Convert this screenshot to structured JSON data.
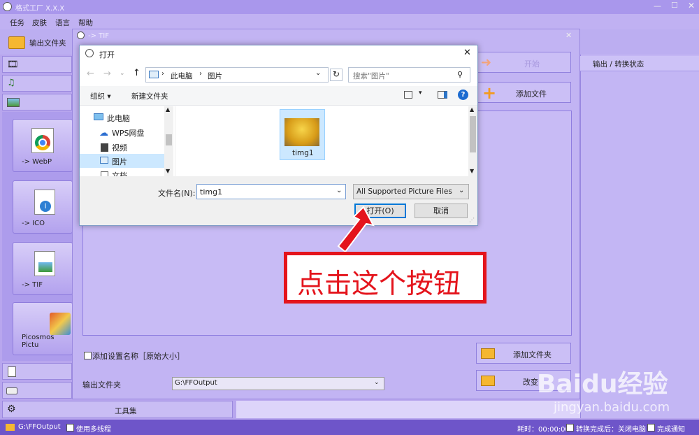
{
  "app": {
    "title": "格式工厂 X.X.X",
    "menu": [
      "任务",
      "皮肤",
      "语言",
      "帮助"
    ],
    "toolbar_output_folder": "输出文件夹",
    "format_buttons": [
      "-> WebP",
      "-> ICO",
      "-> TIF",
      "Picosmos Pictu"
    ],
    "toolset_label": "工具集",
    "right_buttons": {
      "start": "开始",
      "add_file": "添加文件",
      "add_folder": "添加文件夹",
      "change": "改变"
    },
    "status_header": "输出 / 转换状态",
    "add_setting_name": "添加设置名称［原始大小］",
    "output_folder_label": "输出文件夹",
    "output_folder_value": "G:\\FFOutput",
    "inner_window_title": "-> TIF",
    "bottom": {
      "path": "G:\\FFOutput",
      "multithread": "使用多线程",
      "elapsed": "耗时：00:00:00",
      "after_convert": "转换完成后：关闭电脑",
      "notify": "完成通知"
    }
  },
  "dialog": {
    "title": "打开",
    "breadcrumb": [
      "此电脑",
      "图片"
    ],
    "search_placeholder": "搜索\"图片\"",
    "organize": "组织 ▾",
    "new_folder": "新建文件夹",
    "nav_items": [
      "此电脑",
      "WPS网盘",
      "视频",
      "图片",
      "文档"
    ],
    "file_name": "timg1",
    "file_name_label": "文件名(N):",
    "file_type": "All Supported Picture Files",
    "open_button": "打开(O)",
    "cancel_button": "取消"
  },
  "annotation": {
    "text": "点击这个按钮"
  },
  "watermark": {
    "logo": "Baidu经验",
    "url": "jingyan.baidu.com"
  },
  "colors": {
    "accent": "#e4141c",
    "app_bg": "#b8a6ee",
    "selection": "#cce8ff",
    "status_bar": "#6e55c9"
  }
}
